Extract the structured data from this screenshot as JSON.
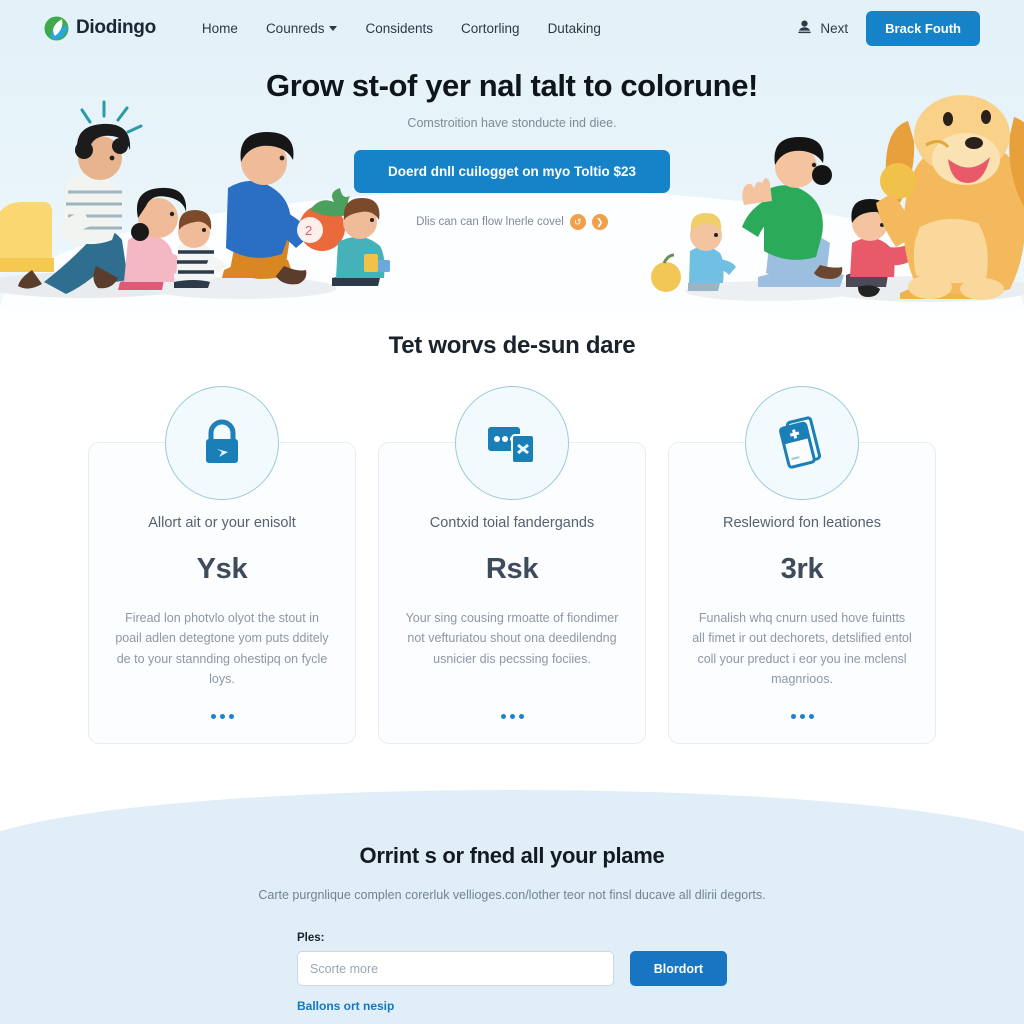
{
  "brand": {
    "name": "Diodingo",
    "logo_icon": "leaf-circle-icon"
  },
  "nav": {
    "items": [
      {
        "label": "Home",
        "has_caret": false
      },
      {
        "label": "Counreds",
        "has_caret": true
      },
      {
        "label": "Considents",
        "has_caret": false
      },
      {
        "label": "Cortorling",
        "has_caret": false
      },
      {
        "label": "Dutaking",
        "has_caret": false
      }
    ],
    "user_label": "Next",
    "user_icon": "user-account-icon",
    "cta_label": "Brack Fouth"
  },
  "hero": {
    "title": "Grow st-of yer nal talt to colorune!",
    "subtitle": "Comstroition have stonducte ind diee.",
    "button_label": "Doerd dnll cuilogget on myo Toltio $23",
    "note": "Dlis can can flow lnerle covel",
    "badges": [
      "↺",
      "❯"
    ],
    "badge_color": "#f0a04a"
  },
  "features": {
    "section_title": "Tet worvs de-sun dare",
    "cards": [
      {
        "icon": "lock-icon",
        "title": "Allort ait or your enisolt",
        "word": "Ysk",
        "body": "Firead lon photvlo olyot the stout in poail adlen detegtone yom puts dditely de to your stannding ohestipq on fycle loys."
      },
      {
        "icon": "cards-stack-icon",
        "title": "Contxid toial fandergands",
        "word": "Rsk",
        "body": "Your sing cousing rmoatte of fiondimer not vefturiatou shout ona deedilendng usnicier dis pecssing fociies."
      },
      {
        "icon": "phone-card-plus-icon",
        "title": "Reslewiord fon leationes",
        "word": "3rk",
        "body": "Funalish whq cnurn used hove fuintts all fimet ir out dechorets, detslified entol coll your preduct i eor you ine mclensl magnrioos."
      }
    ]
  },
  "bottom": {
    "title": "Orrint s or fned all your plame",
    "subtitle": "Carte purgnlique complen corerluk vellioges.con/lother teor not finsl ducave all dlirii degorts.",
    "form_label": "Ples:",
    "input_placeholder": "Scorte more",
    "input_value": "",
    "button_label": "Blordort",
    "link_label": "Ballons ort nesip"
  },
  "colors": {
    "accent_blue": "#1683c8",
    "header_bg": "#e3f1f8",
    "icon_blue": "#1f7fb8",
    "dot_blue": "#1f7fd0"
  }
}
